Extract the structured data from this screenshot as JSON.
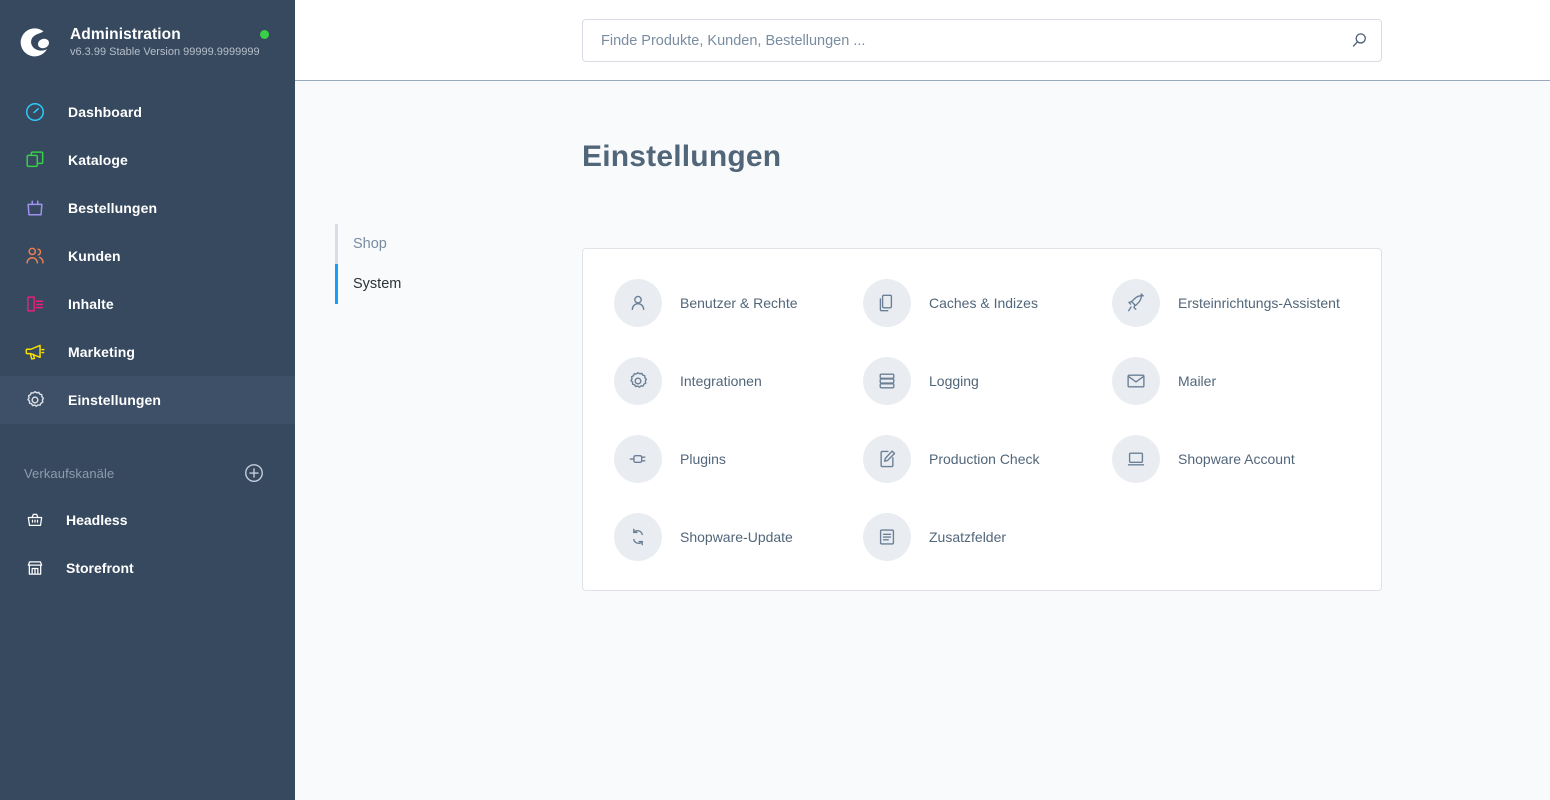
{
  "sidebar": {
    "brand": {
      "title": "Administration",
      "version": "v6.3.99 Stable Version 99999.9999999",
      "logo_icon": "shopware-logo-icon",
      "status_icon": "status-dot-online",
      "status_color": "#37d046"
    },
    "nav_items": [
      {
        "label": "Dashboard",
        "icon": "dashboard-icon",
        "color": "#2ecbff",
        "active": false
      },
      {
        "label": "Kataloge",
        "icon": "catalog-icon",
        "color": "#37d046",
        "active": false
      },
      {
        "label": "Bestellungen",
        "icon": "orders-bag-icon",
        "color": "#a092f0",
        "active": false
      },
      {
        "label": "Kunden",
        "icon": "customers-icon",
        "color": "#ed7f50",
        "active": false
      },
      {
        "label": "Inhalte",
        "icon": "content-icon",
        "color": "#ed1d78",
        "active": false
      },
      {
        "label": "Marketing",
        "icon": "megaphone-icon",
        "color": "#fae000",
        "active": false
      },
      {
        "label": "Einstellungen",
        "icon": "gear-icon",
        "color": "#d8dde3",
        "active": true
      }
    ],
    "sales_channels": {
      "title": "Verkaufskanäle",
      "add_icon": "plus-circle-icon",
      "items": [
        {
          "label": "Headless",
          "icon": "basket-icon"
        },
        {
          "label": "Storefront",
          "icon": "storefront-icon"
        }
      ]
    }
  },
  "topbar": {
    "search": {
      "placeholder": "Finde Produkte, Kunden, Bestellungen ...",
      "value": "",
      "icon": "search-icon"
    }
  },
  "main": {
    "page_title": "Einstellungen",
    "tabs": [
      {
        "label": "Shop",
        "active": false
      },
      {
        "label": "System",
        "active": true
      }
    ],
    "accent_color": "#189eff",
    "settings_tiles": [
      {
        "label": "Benutzer & Rechte",
        "icon": "user-icon"
      },
      {
        "label": "Caches & Indizes",
        "icon": "copy-documents-icon"
      },
      {
        "label": "Ersteinrichtungs-Assistent",
        "icon": "rocket-icon"
      },
      {
        "label": "Integrationen",
        "icon": "gear-icon"
      },
      {
        "label": "Logging",
        "icon": "database-icon"
      },
      {
        "label": "Mailer",
        "icon": "envelope-icon"
      },
      {
        "label": "Plugins",
        "icon": "plug-icon"
      },
      {
        "label": "Production Check",
        "icon": "document-edit-icon"
      },
      {
        "label": "Shopware Account",
        "icon": "laptop-icon"
      },
      {
        "label": "Shopware-Update",
        "icon": "refresh-icon"
      },
      {
        "label": "Zusatzfelder",
        "icon": "list-document-icon"
      }
    ]
  }
}
